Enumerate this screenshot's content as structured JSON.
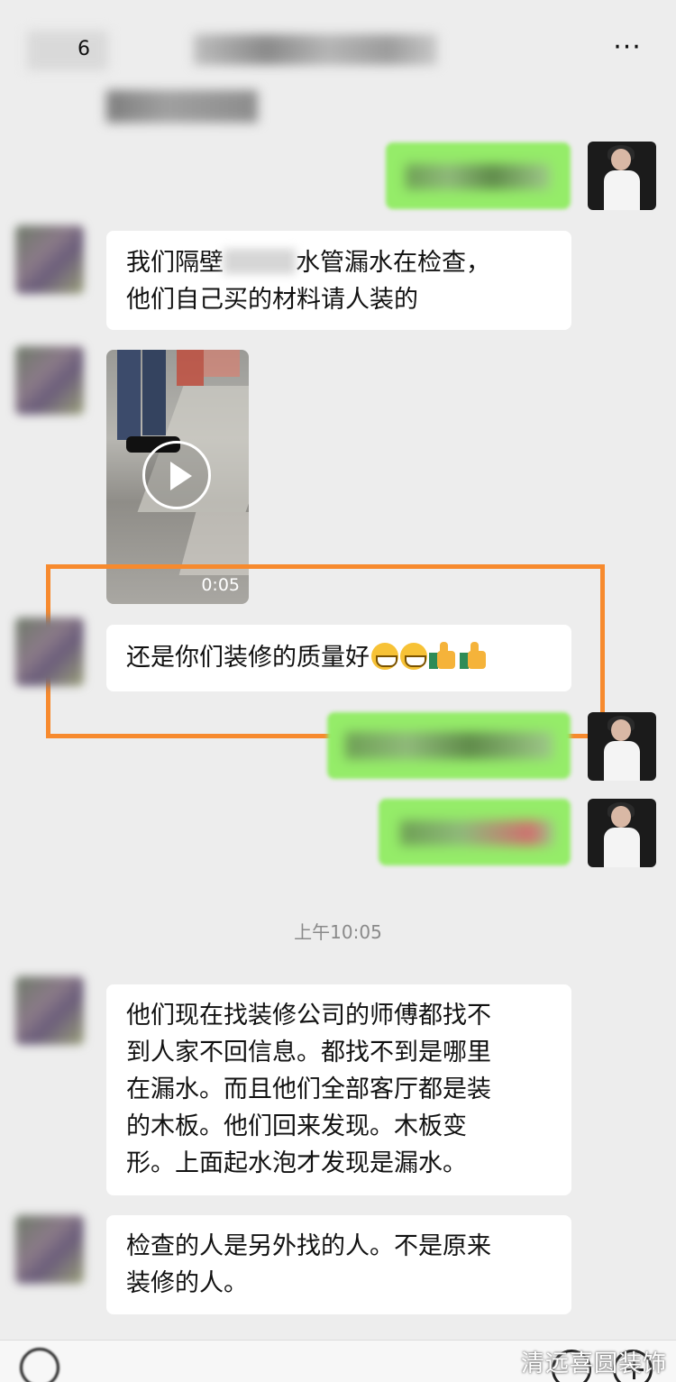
{
  "header": {
    "back_count": "6",
    "more_icon": "more-dots-icon",
    "more_label": "···"
  },
  "messages": {
    "m1_text_lines": [
      "我们隔壁",
      "水管漏水在检查，",
      "他们自己买的材料请人装的"
    ],
    "m1_line1": "我们隔壁 ⸻ 水管漏水在检查，",
    "m1_line2": "他们自己买的材料请人装的",
    "video_duration": "0:05",
    "m3_text": "还是你们装修的质量好",
    "timestamp": "上午10:05",
    "m7_lines": [
      "他们现在找装修公司的师傅都找不",
      "到人家不回信息。都找不到是哪里",
      "在漏水。而且他们全部客厅都是装",
      "的木板。他们回来发现。木板变",
      "形。上面起水泡才发现是漏水。"
    ],
    "m8_lines": [
      "检查的人是另外找的人。不是原来",
      "装修的人。"
    ]
  },
  "colors": {
    "background": "#ededed",
    "bubble_white": "#ffffff",
    "bubble_green": "#95ec69",
    "highlight": "#f78a2e"
  },
  "watermark": "清远喜圆装饰"
}
